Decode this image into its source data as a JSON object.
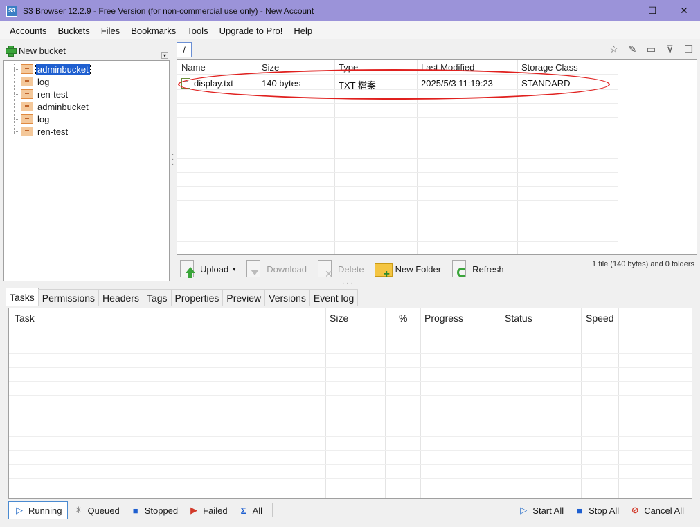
{
  "window": {
    "app_icon_text": "S3",
    "title": "S3 Browser 12.2.9 - Free Version (for non-commercial use only) - New Account",
    "minimize": "—",
    "maximize": "☐",
    "close": "✕"
  },
  "menu": [
    "Accounts",
    "Buckets",
    "Files",
    "Bookmarks",
    "Tools",
    "Upgrade to Pro!",
    "Help"
  ],
  "left_panel": {
    "new_bucket_label": "New bucket",
    "dropdown_glyph": "▾",
    "buckets": [
      {
        "label": "adminbucket",
        "selected": true
      },
      {
        "label": "log",
        "selected": false
      },
      {
        "label": "ren-test",
        "selected": false
      },
      {
        "label": "adminbucket",
        "selected": false
      },
      {
        "label": "log",
        "selected": false
      },
      {
        "label": "ren-test",
        "selected": false
      }
    ]
  },
  "path_tab": "/",
  "right_icons": [
    "star-icon",
    "pencil-icon",
    "window-icon",
    "filter-icon",
    "copy-icon"
  ],
  "right_icon_glyphs": [
    "☆",
    "✎",
    "▭",
    "⊽",
    "❐"
  ],
  "file_list": {
    "columns": [
      "Name",
      "Size",
      "Type",
      "Last Modified",
      "Storage Class"
    ],
    "rows": [
      {
        "name": "display.txt",
        "size": "140 bytes",
        "type": "TXT 檔案",
        "modified": "2025/5/3 11:19:23",
        "storage": "STANDARD"
      }
    ]
  },
  "actions": {
    "upload": "Upload",
    "upload_caret": "▾",
    "download": "Download",
    "delete": "Delete",
    "new_folder": "New Folder",
    "refresh": "Refresh"
  },
  "status_text": "1 file (140 bytes) and 0 folders",
  "tabs": [
    "Tasks",
    "Permissions",
    "Headers",
    "Tags",
    "Properties",
    "Preview",
    "Versions",
    "Event log"
  ],
  "tasks": {
    "columns": [
      "Task",
      "Size",
      "%",
      "Progress",
      "Status",
      "Speed"
    ]
  },
  "bottom": {
    "running": "Running",
    "queued": "Queued",
    "stopped": "Stopped",
    "failed": "Failed",
    "all": "All",
    "start_all": "Start All",
    "stop_all": "Stop All",
    "cancel_all": "Cancel All"
  },
  "colors": {
    "titlebar": "#9b93d9",
    "selection": "#1e5fd0",
    "highlight_ellipse": "#e0201e"
  }
}
